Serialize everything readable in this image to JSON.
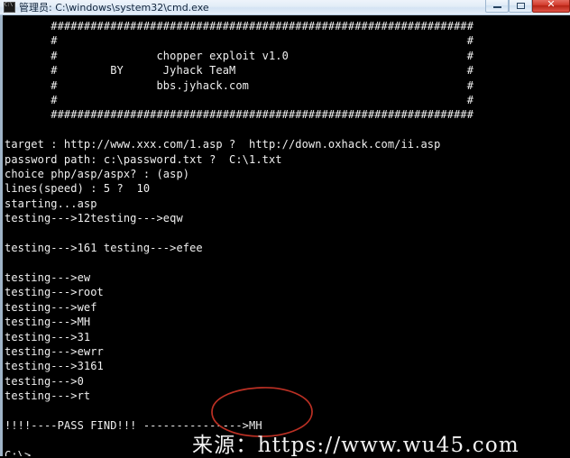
{
  "window": {
    "title": "管理员: C:\\windows\\system32\\cmd.exe",
    "icon": "cmd-icon",
    "controls": {
      "minimize_label": "",
      "maximize_label": "",
      "close_label": ""
    }
  },
  "console": {
    "banner": {
      "border_char": "#",
      "line1": "################################################################",
      "line2": "#                                                              #",
      "title": "chopper exploit v1.0",
      "author_prefix": "BY",
      "author": "Jyhack TeaM",
      "site": "bbs.jyhack.com"
    },
    "config": {
      "target_label": "target :",
      "target_default": "http://www.xxx.com/1.asp ?",
      "target_value": "http://down.oxhack.com/ii.asp",
      "password_path_label": "password path:",
      "password_path_default": "c:\\password.txt ?",
      "password_path_value": "C:\\1.txt",
      "choice_label": "choice php/asp/aspx? :",
      "choice_value": "(asp)",
      "lines_label": "lines(speed) : 5 ?",
      "lines_value": "10",
      "starting": "starting...asp"
    },
    "testing_prefix": "testing--->",
    "attempts": [
      "12testing--->eqw",
      "161 testing--->efee",
      "ew",
      "root",
      "wef",
      "MH",
      "31",
      "ewrr",
      "3161",
      "0",
      "rt"
    ],
    "result": {
      "prefix": "!!!!----PASS FIND!!!",
      "arrow": "--------------->",
      "password": "MH"
    },
    "prompt": "C:\\>",
    "full_text": "       ################################################################\n       #                                                              #\n       #               chopper exploit v1.0                           #\n       #        BY      Jyhack TeaM                                   #\n       #               bbs.jyhack.com                                 #\n       #                                                              #\n       ################################################################\n\ntarget : http://www.xxx.com/1.asp ?  http://down.oxhack.com/ii.asp\npassword path: c:\\password.txt ?  C:\\1.txt\nchoice php/asp/aspx? : (asp)\nlines(speed) : 5 ?  10\nstarting...asp\ntesting--->12testing--->eqw\n\ntesting--->161 testing--->efee\n\ntesting--->ew\ntesting--->root\ntesting--->wef\ntesting--->MH\ntesting--->31\ntesting--->ewrr\ntesting--->3161\ntesting--->0\ntesting--->rt\n\n!!!!----PASS FIND!!! --------------->MH\n\nC:\\>"
  },
  "annotation": {
    "shape": "hand-drawn-ellipse",
    "color": "#c0392b",
    "encircles": ">MH"
  },
  "watermark": {
    "text": "来源：https://www.wu45.com"
  },
  "colors": {
    "console_bg": "#000000",
    "console_text": "#f0f0f0",
    "titlebar": "#e2ecf7",
    "close_button": "#c0392b",
    "annotation_red": "#c0392b"
  }
}
